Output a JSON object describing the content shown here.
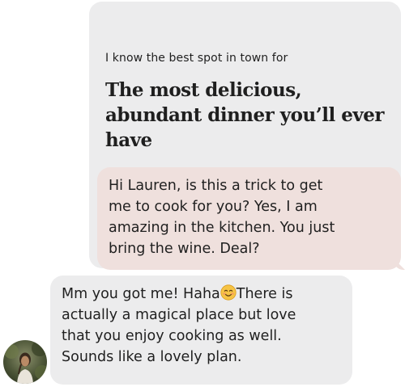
{
  "prompt": {
    "label": "I know the best spot in town for",
    "answer": "The most delicious, abundant dinner you’ll ever have"
  },
  "messages": {
    "reply": {
      "text": "Hi Lauren, is this a trick to get\nme to cook for you? Yes, I am\namazing in the kitchen. You just\nbring the wine. Deal?"
    },
    "incoming": {
      "text_before_emoji": "Mm you got me! Haha",
      "emoji": "smiling-face-icon",
      "text_after_emoji": "There is\nactually a magical place but love\nthat you enjoy cooking as well.\nSounds like a lovely plan."
    }
  },
  "colors": {
    "prompt_bg": "#ececed",
    "reply_bg": "#efe0dd",
    "incoming_bg": "#ececed",
    "text": "#1f1f1f"
  }
}
